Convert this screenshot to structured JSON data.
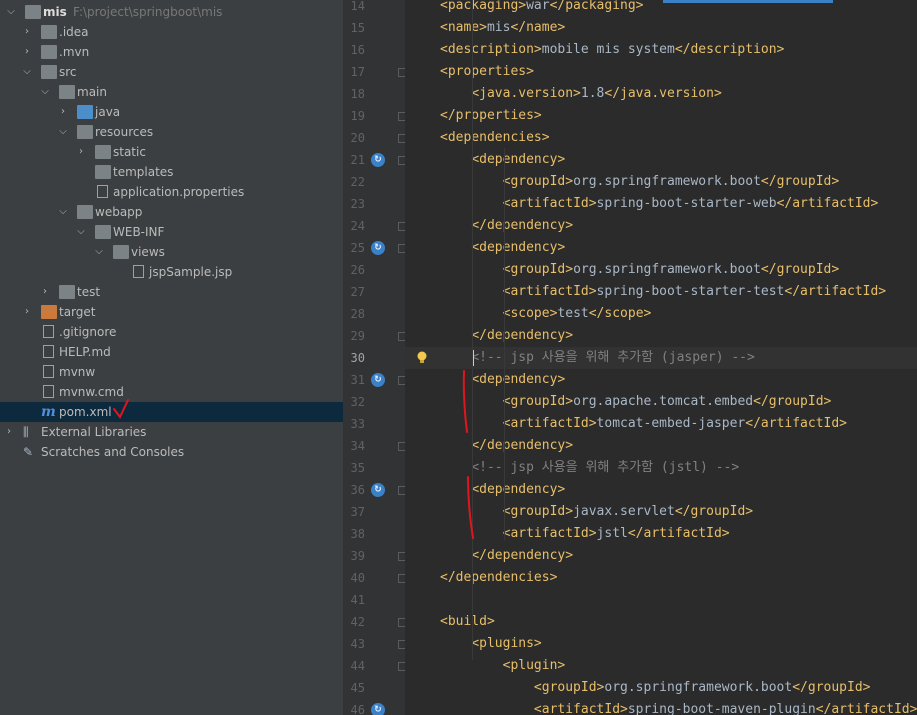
{
  "project_tree": {
    "root": {
      "name": "mis",
      "path": "F:\\project\\springboot\\mis"
    },
    "items": [
      {
        "label": "mis",
        "icon": "folder-icon"
      },
      {
        "label": ".idea",
        "icon": "folder-icon"
      },
      {
        "label": ".mvn",
        "icon": "folder-icon"
      },
      {
        "label": "src",
        "icon": "folder-icon"
      },
      {
        "label": "main",
        "icon": "folder-icon"
      },
      {
        "label": "java",
        "icon": "source-folder-icon"
      },
      {
        "label": "resources",
        "icon": "resources-folder-icon"
      },
      {
        "label": "static",
        "icon": "folder-icon"
      },
      {
        "label": "templates",
        "icon": "folder-icon"
      },
      {
        "label": "application.properties",
        "icon": "properties-file-icon"
      },
      {
        "label": "webapp",
        "icon": "folder-icon"
      },
      {
        "label": "WEB-INF",
        "icon": "folder-icon"
      },
      {
        "label": "views",
        "icon": "folder-icon"
      },
      {
        "label": "jspSample.jsp",
        "icon": "jsp-file-icon"
      },
      {
        "label": "test",
        "icon": "folder-icon"
      },
      {
        "label": "target",
        "icon": "excluded-folder-icon"
      },
      {
        "label": ".gitignore",
        "icon": "text-file-icon"
      },
      {
        "label": "HELP.md",
        "icon": "markdown-file-icon"
      },
      {
        "label": "mvnw",
        "icon": "shell-file-icon"
      },
      {
        "label": "mvnw.cmd",
        "icon": "text-file-icon"
      },
      {
        "label": "pom.xml",
        "icon": "maven-icon"
      },
      {
        "label": "External Libraries",
        "icon": "libraries-icon"
      },
      {
        "label": "Scratches and Consoles",
        "icon": "scratches-icon"
      }
    ]
  },
  "editor": {
    "current_line": 30,
    "lines": [
      {
        "n": "14",
        "code": [
          [
            "tag",
            "<packaging>"
          ],
          [
            "txt",
            "war"
          ],
          [
            "tag",
            "</packaging>"
          ]
        ]
      },
      {
        "n": "15",
        "code": [
          [
            "tag",
            "<name>"
          ],
          [
            "txt",
            "mis"
          ],
          [
            "tag",
            "</name>"
          ]
        ]
      },
      {
        "n": "16",
        "code": [
          [
            "tag",
            "<description>"
          ],
          [
            "txt",
            "mobile mis system"
          ],
          [
            "tag",
            "</description>"
          ]
        ]
      },
      {
        "n": "17",
        "code": [
          [
            "tag",
            "<properties>"
          ]
        ]
      },
      {
        "n": "18",
        "code": [
          [
            "txt",
            "    "
          ],
          [
            "tag",
            "<java.version>"
          ],
          [
            "txt",
            "1.8"
          ],
          [
            "tag",
            "</java.version>"
          ]
        ]
      },
      {
        "n": "19",
        "code": [
          [
            "tag",
            "</properties>"
          ]
        ]
      },
      {
        "n": "20",
        "code": [
          [
            "tag",
            "<dependencies>"
          ]
        ]
      },
      {
        "n": "21",
        "code": [
          [
            "txt",
            "    "
          ],
          [
            "tag",
            "<dependency>"
          ]
        ]
      },
      {
        "n": "22",
        "code": [
          [
            "txt",
            "        "
          ],
          [
            "tag",
            "<groupId>"
          ],
          [
            "txt",
            "org.springframework.boot"
          ],
          [
            "tag",
            "</groupId>"
          ]
        ]
      },
      {
        "n": "23",
        "code": [
          [
            "txt",
            "        "
          ],
          [
            "tag",
            "<artifactId>"
          ],
          [
            "txt",
            "spring-boot-starter-web"
          ],
          [
            "tag",
            "</artifactId>"
          ]
        ]
      },
      {
        "n": "24",
        "code": [
          [
            "txt",
            "    "
          ],
          [
            "tag",
            "</dependency>"
          ]
        ]
      },
      {
        "n": "25",
        "code": [
          [
            "txt",
            "    "
          ],
          [
            "tag",
            "<dependency>"
          ]
        ]
      },
      {
        "n": "26",
        "code": [
          [
            "txt",
            "        "
          ],
          [
            "tag",
            "<groupId>"
          ],
          [
            "txt",
            "org.springframework.boot"
          ],
          [
            "tag",
            "</groupId>"
          ]
        ]
      },
      {
        "n": "27",
        "code": [
          [
            "txt",
            "        "
          ],
          [
            "tag",
            "<artifactId>"
          ],
          [
            "txt",
            "spring-boot-starter-test"
          ],
          [
            "tag",
            "</artifactId>"
          ]
        ]
      },
      {
        "n": "28",
        "code": [
          [
            "txt",
            "        "
          ],
          [
            "tag",
            "<scope>"
          ],
          [
            "txt",
            "test"
          ],
          [
            "tag",
            "</scope>"
          ]
        ]
      },
      {
        "n": "29",
        "code": [
          [
            "txt",
            "    "
          ],
          [
            "tag",
            "</dependency>"
          ]
        ]
      },
      {
        "n": "30",
        "code": [
          [
            "txt",
            "    "
          ],
          [
            "cmt",
            "<!-- jsp 사용을 위해 추가함 (jasper) -->"
          ]
        ]
      },
      {
        "n": "31",
        "code": [
          [
            "txt",
            "    "
          ],
          [
            "tag",
            "<dependency>"
          ]
        ]
      },
      {
        "n": "32",
        "code": [
          [
            "txt",
            "        "
          ],
          [
            "tag",
            "<groupId>"
          ],
          [
            "txt",
            "org.apache.tomcat.embed"
          ],
          [
            "tag",
            "</groupId>"
          ]
        ]
      },
      {
        "n": "33",
        "code": [
          [
            "txt",
            "        "
          ],
          [
            "tag",
            "<artifactId>"
          ],
          [
            "txt",
            "tomcat-embed-jasper"
          ],
          [
            "tag",
            "</artifactId>"
          ]
        ]
      },
      {
        "n": "34",
        "code": [
          [
            "txt",
            "    "
          ],
          [
            "tag",
            "</dependency>"
          ]
        ]
      },
      {
        "n": "35",
        "code": [
          [
            "txt",
            "    "
          ],
          [
            "cmt",
            "<!-- jsp 사용을 위해 추가함 (jstl) -->"
          ]
        ]
      },
      {
        "n": "36",
        "code": [
          [
            "txt",
            "    "
          ],
          [
            "tag",
            "<dependency>"
          ]
        ]
      },
      {
        "n": "37",
        "code": [
          [
            "txt",
            "        "
          ],
          [
            "tag",
            "<groupId>"
          ],
          [
            "txt",
            "javax.servlet"
          ],
          [
            "tag",
            "</groupId>"
          ]
        ]
      },
      {
        "n": "38",
        "code": [
          [
            "txt",
            "        "
          ],
          [
            "tag",
            "<artifactId>"
          ],
          [
            "txt",
            "jstl"
          ],
          [
            "tag",
            "</artifactId>"
          ]
        ]
      },
      {
        "n": "39",
        "code": [
          [
            "txt",
            "    "
          ],
          [
            "tag",
            "</dependency>"
          ]
        ]
      },
      {
        "n": "40",
        "code": [
          [
            "tag",
            "</dependencies>"
          ]
        ]
      },
      {
        "n": "41",
        "code": []
      },
      {
        "n": "42",
        "code": [
          [
            "tag",
            "<build>"
          ]
        ]
      },
      {
        "n": "43",
        "code": [
          [
            "txt",
            "    "
          ],
          [
            "tag",
            "<plugins>"
          ]
        ]
      },
      {
        "n": "44",
        "code": [
          [
            "txt",
            "        "
          ],
          [
            "tag",
            "<plugin>"
          ]
        ]
      },
      {
        "n": "45",
        "code": [
          [
            "txt",
            "            "
          ],
          [
            "tag",
            "<groupId>"
          ],
          [
            "txt",
            "org.springframework.boot"
          ],
          [
            "tag",
            "</groupId>"
          ]
        ]
      },
      {
        "n": "46",
        "code": [
          [
            "txt",
            "            "
          ],
          [
            "tag",
            "<artifactId>"
          ],
          [
            "txt",
            "spring-boot-maven-plugin"
          ],
          [
            "tag",
            "</artifactId>"
          ]
        ]
      }
    ]
  },
  "colors": {
    "tag": "#e8bf6a",
    "text": "#a9b7c6",
    "comment": "#808080",
    "tree_bg": "#3c3f41",
    "editor_bg": "#2b2b2b",
    "selection": "#0d293e",
    "annotation": "#e0161e"
  }
}
